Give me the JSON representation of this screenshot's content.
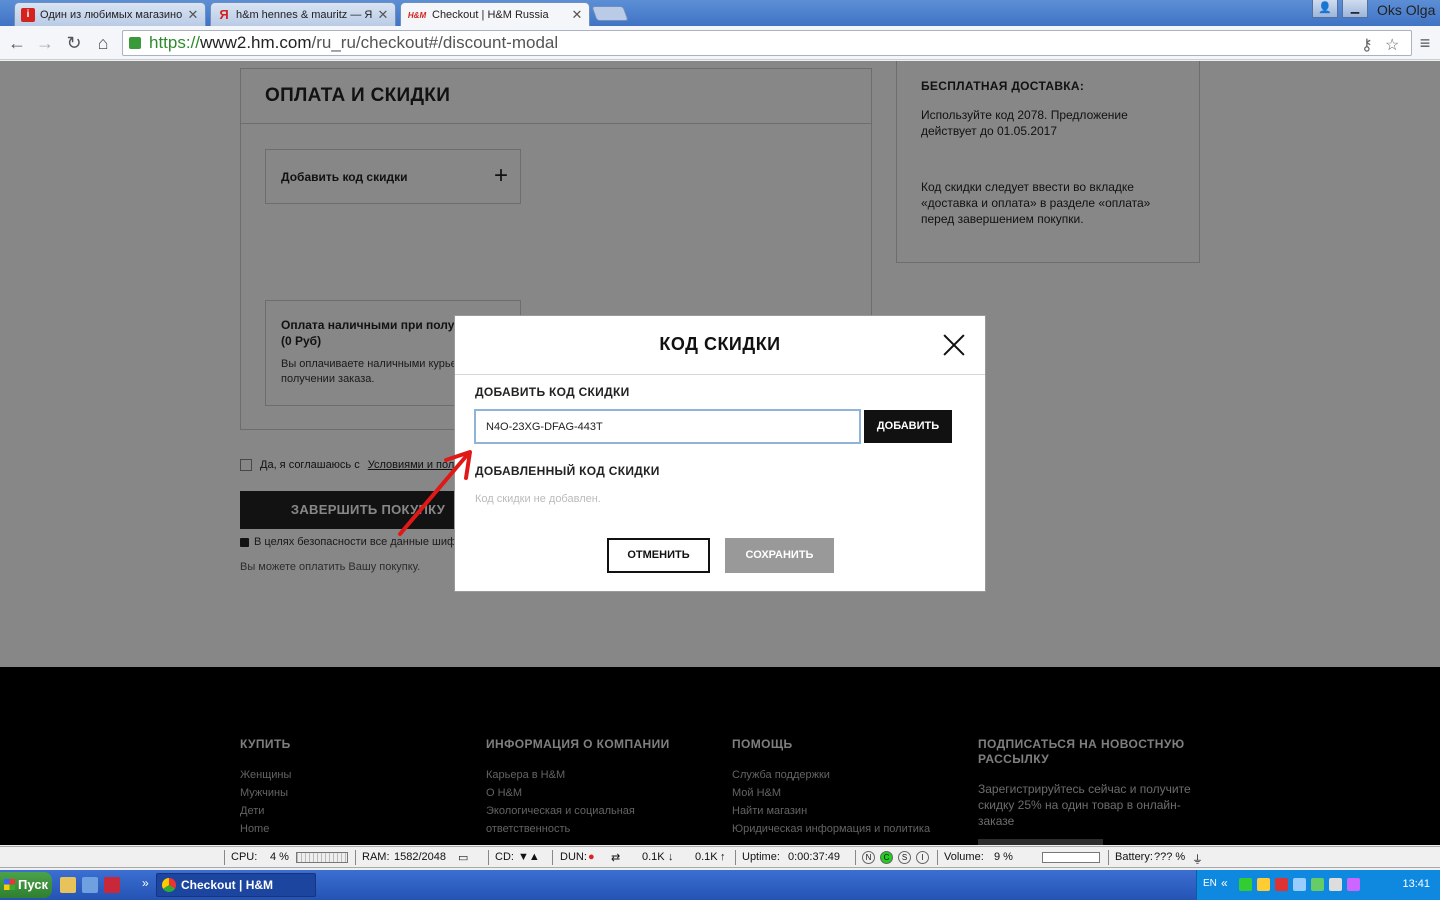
{
  "browser": {
    "tabs": [
      {
        "title": "Один из любимых магазинов",
        "favicon_letter": "i",
        "favicon_color": "#d4231f",
        "active": false
      },
      {
        "title": "h&m hennes & mauritz — Ян",
        "favicon_letter": "Я",
        "favicon_color": "#ffffff",
        "active": false
      },
      {
        "title": "Checkout | H&M Russia",
        "favicon_letter": "H&M",
        "favicon_color": "#ffffff",
        "active": true
      }
    ],
    "profile": "Oks Olga",
    "url_scheme": "https://",
    "url_host": "www2.hm.com",
    "url_path": "/ru_ru/checkout#/discount-modal"
  },
  "checkout": {
    "section_title": "ОПЛАТА И СКИДКИ",
    "discount_option": "Добавить код скидки",
    "plus": "+",
    "cash_title": "Оплата наличными при получе",
    "cash_price": "(0 Руб)",
    "cash_desc": "Вы оплачиваете наличными курье получении заказа.",
    "agree_text": "Да, я соглашаюсь с",
    "agree_link": "Условиями и пол",
    "finish_button": "ЗАВЕРШИТЬ ПОКУПКУ",
    "secure_text": "В целях безопасности все данные шиф",
    "pay_note": "Вы можете оплатить Вашу покупку."
  },
  "promo": {
    "title": "БЕСПЛАТНАЯ ДОСТАВКА:",
    "p1": "Используйте код 2078. Предложение действует до 01.05.2017",
    "p2": "Код скидки следует ввести во вкладке «доставка и оплата» в разделе «оплата» перед завершением покупки."
  },
  "modal": {
    "title": "КОД СКИДКИ",
    "add_label": "ДОБАВИТЬ КОД СКИДКИ",
    "input_value": "N4O-23XG-DFAG-443T",
    "add_button": "ДОБАВИТЬ",
    "added_label": "ДОБАВЛЕННЫЙ КОД СКИДКИ",
    "empty_message": "Код скидки не добавлен.",
    "cancel_button": "ОТМЕНИТЬ",
    "save_button": "СОХРАНИТЬ"
  },
  "footer": {
    "columns": [
      {
        "title": "КУПИТЬ",
        "links": [
          "Женщины",
          "Мужчины",
          "Дети",
          "Home"
        ]
      },
      {
        "title": "ИНФОРМАЦИЯ О КОМПАНИИ",
        "links": [
          "Карьера в H&M",
          "О H&M",
          "Экологическая и социальная",
          "ответственность"
        ]
      },
      {
        "title": "ПОМОЩЬ",
        "links": [
          "Служба поддержки",
          "Мой H&M",
          "Найти магазин",
          "Юридическая информация и политика"
        ]
      }
    ],
    "subscribe_title": "ПОДПИСАТЬСЯ НА НОВОСТНУЮ РАССЫЛКУ",
    "subscribe_text": "Зарегистрируйтесь сейчас и получите скидку 25% на один товар в онлайн-заказе"
  },
  "statusbar": {
    "cpu_label": "CPU:",
    "cpu_value": "4 %",
    "ram_label": "RAM:",
    "ram_value": "1582/2048",
    "cd_label": "CD:",
    "dun_label": "DUN:",
    "down_value": "0.1K",
    "up_value": "0.1K",
    "uptime_label": "Uptime:",
    "uptime_value": "0:00:37:49",
    "volume_label": "Volume:",
    "volume_value": "9 %",
    "battery_label": "Battery:",
    "battery_value": "??? %"
  },
  "taskbar": {
    "start": "Пуск",
    "task": "Checkout | H&M Russ...",
    "lang": "EN",
    "clock": "13:41"
  }
}
